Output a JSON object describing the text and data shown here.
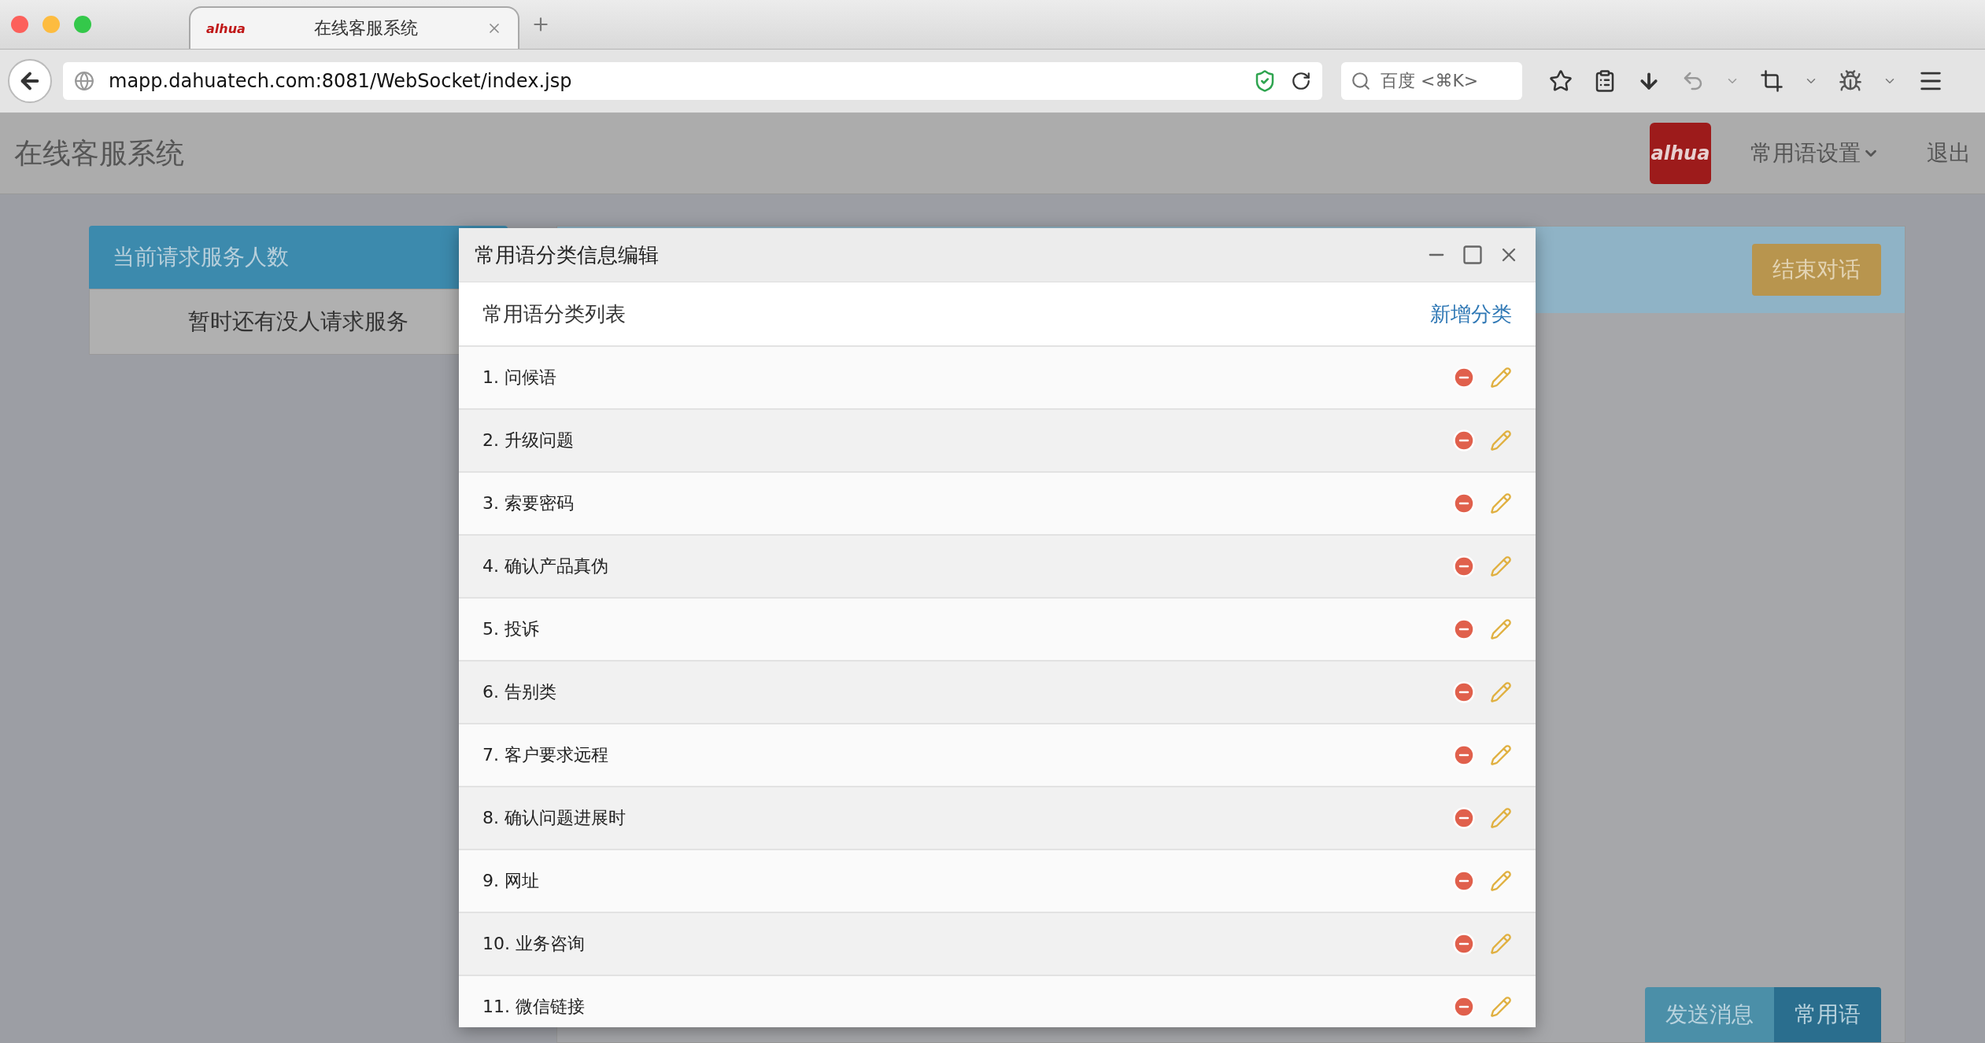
{
  "browser": {
    "tab": {
      "title": "在线客服系统",
      "logo": "alhua"
    },
    "url": "mapp.dahuatech.com:8081/WebSocket/index.jsp",
    "search_placeholder": "百度 <⌘K>"
  },
  "app": {
    "title": "在线客服系统",
    "logo": "alhua",
    "settings_menu": "常用语设置",
    "logout": "退出"
  },
  "left_panel": {
    "title": "当前请求服务人数",
    "empty_message": "暂时还有没人请求服务"
  },
  "right_panel": {
    "end_button": "结束对话",
    "send_button": "发送消息",
    "phrases_button": "常用语"
  },
  "dialog": {
    "title": "常用语分类信息编辑",
    "list_title": "常用语分类列表",
    "add_link": "新增分类",
    "rows": [
      {
        "label": "1. 问候语"
      },
      {
        "label": "2. 升级问题"
      },
      {
        "label": "3. 索要密码"
      },
      {
        "label": "4. 确认产品真伪"
      },
      {
        "label": "5. 投诉"
      },
      {
        "label": "6. 告别类"
      },
      {
        "label": "7. 客户要求远程"
      },
      {
        "label": "8. 确认问题进展时"
      },
      {
        "label": "9. 网址"
      },
      {
        "label": "10. 业务咨询"
      },
      {
        "label": "11. 微信链接"
      }
    ]
  }
}
